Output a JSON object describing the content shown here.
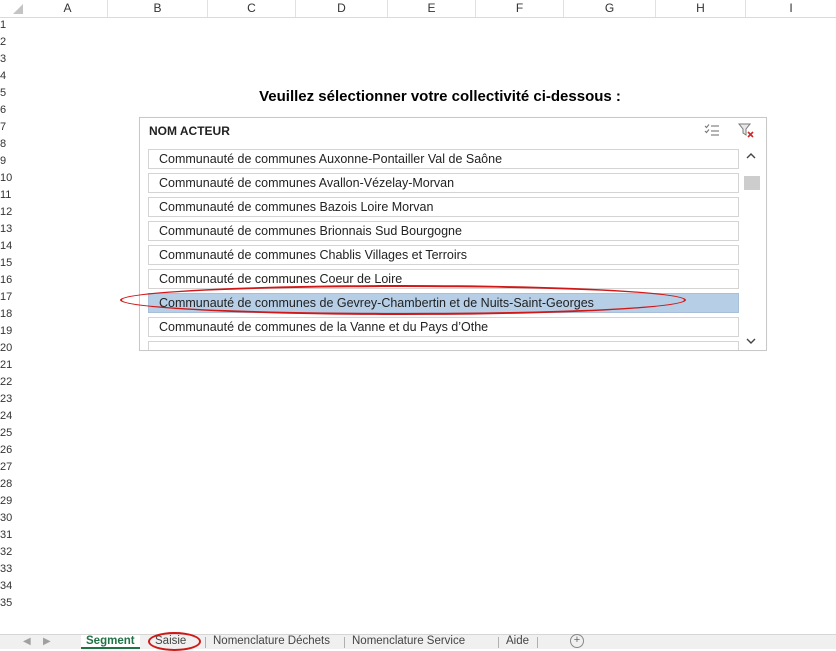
{
  "column_headers": [
    "A",
    "B",
    "C",
    "D",
    "E",
    "F",
    "G",
    "H",
    "I"
  ],
  "row_headers": [
    "1",
    "2",
    "3",
    "4",
    "5",
    "6",
    "7",
    "8",
    "9",
    "10",
    "11",
    "12",
    "13",
    "14",
    "15",
    "16",
    "17",
    "18",
    "19",
    "20",
    "21",
    "22",
    "23",
    "24",
    "25",
    "26",
    "27",
    "28",
    "29",
    "30",
    "31",
    "32",
    "33",
    "34",
    "35"
  ],
  "instruction": "Veuillez sélectionner votre collectivité ci-dessous :",
  "slicer": {
    "header": "NOM ACTEUR",
    "multiselect_icon": "multi-select-icon",
    "clear_filter_icon": "clear-filter-icon",
    "items": [
      {
        "label": "Communauté de communes Auxonne-Pontailler Val de Saône",
        "selected": false
      },
      {
        "label": "Communauté de communes Avallon-Vézelay-Morvan",
        "selected": false
      },
      {
        "label": "Communauté de communes Bazois Loire Morvan",
        "selected": false
      },
      {
        "label": "Communauté de communes Brionnais Sud Bourgogne",
        "selected": false
      },
      {
        "label": "Communauté de communes Chablis Villages et Terroirs",
        "selected": false
      },
      {
        "label": "Communauté de communes Coeur de Loire",
        "selected": false
      },
      {
        "label": "Communauté de communes de Gevrey-Chambertin et de Nuits-Saint-Georges",
        "selected": true
      },
      {
        "label": "Communauté de communes de la Vanne et du Pays d’Othe",
        "selected": false
      }
    ]
  },
  "sheet_tabs": [
    {
      "label": "Segment",
      "active": true
    },
    {
      "label": "Saisie",
      "active": false
    },
    {
      "label": "Nomenclature Déchets",
      "active": false
    },
    {
      "label": "Nomenclature Service",
      "active": false
    },
    {
      "label": "Aide",
      "active": false
    }
  ],
  "add_sheet_symbol": "+",
  "colors": {
    "selected_item": "#b7cfe6",
    "annotation": "#d01818",
    "active_tab": "#217346"
  }
}
